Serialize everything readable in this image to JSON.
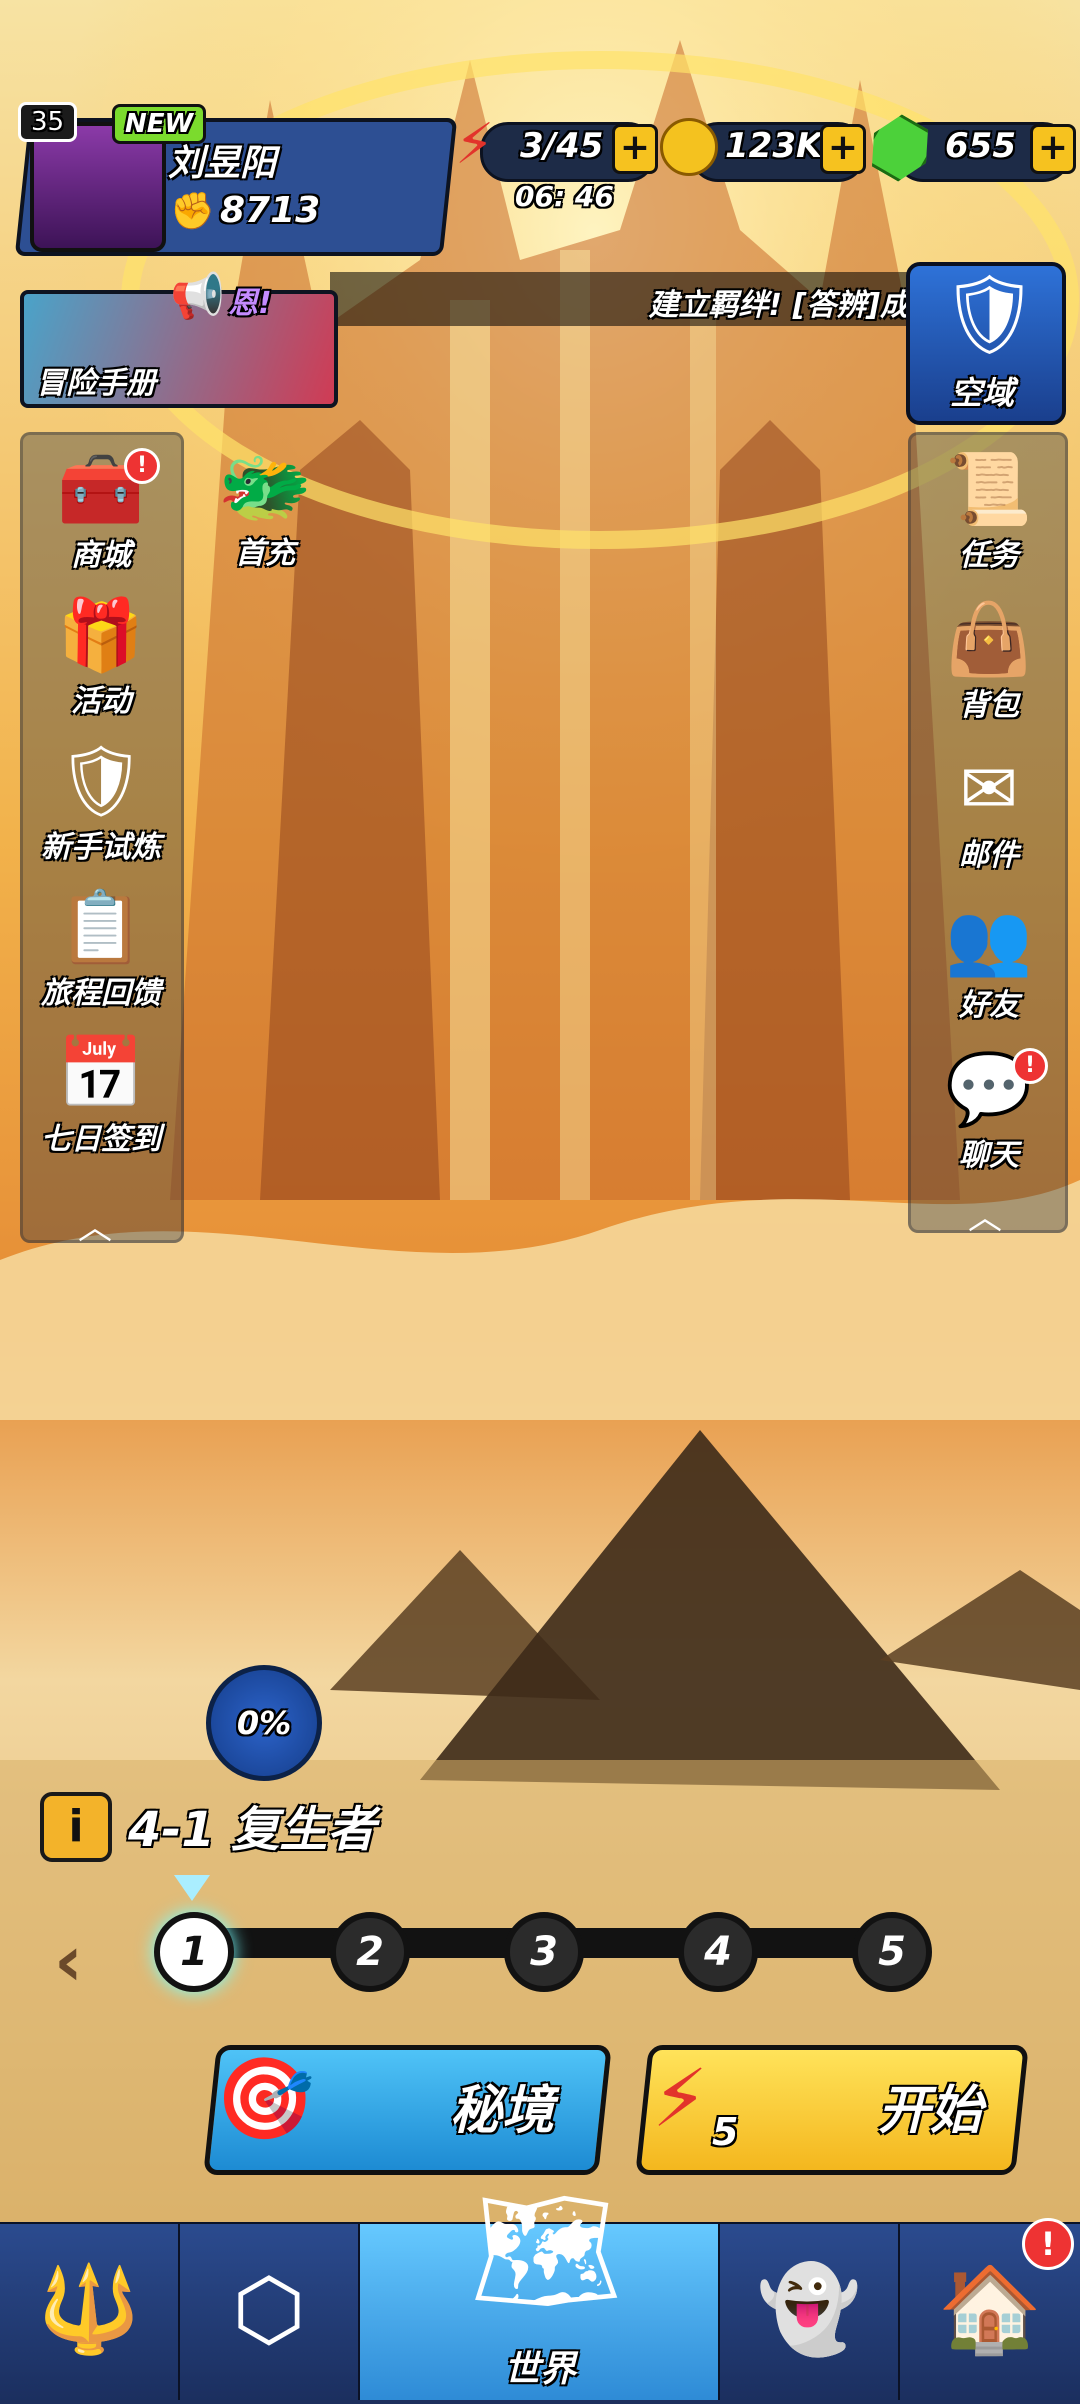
{
  "player": {
    "level": "35",
    "new_badge": "NEW",
    "name": "刘昱阳",
    "power": "8713"
  },
  "resources": {
    "energy": "3/45",
    "energy_timer": "06: 46",
    "gold": "123K",
    "gems": "655",
    "plus": "+"
  },
  "banner": {
    "manual_label": "冒险手册",
    "news_prefix": "恩!",
    "news_text": "建立羁绊! [答辨]成"
  },
  "realm": {
    "label": "空域"
  },
  "left_menu": [
    {
      "label": "商城",
      "icon": "treasure-chest-icon",
      "glyph": "🧰",
      "alert": true
    },
    {
      "label": "活动",
      "icon": "gift-chest-icon",
      "glyph": "🎁",
      "alert": false
    },
    {
      "label": "新手试炼",
      "icon": "shield-sword-icon",
      "glyph": "🛡",
      "alert": false
    },
    {
      "label": "旅程回馈",
      "icon": "clipboard-icon",
      "glyph": "📋",
      "alert": false
    },
    {
      "label": "七日签到",
      "icon": "calendar-icon",
      "glyph": "📅",
      "alert": false
    }
  ],
  "first_pay": {
    "label": "首充",
    "glyph": "🐲"
  },
  "right_menu": [
    {
      "label": "任务",
      "icon": "scroll-icon",
      "glyph": "📜",
      "alert": false
    },
    {
      "label": "背包",
      "icon": "bag-icon",
      "glyph": "👜",
      "alert": false
    },
    {
      "label": "邮件",
      "icon": "mail-icon",
      "glyph": "✉",
      "alert": false
    },
    {
      "label": "好友",
      "icon": "friends-icon",
      "glyph": "👥",
      "alert": false
    },
    {
      "label": "聊天",
      "icon": "chat-icon",
      "glyph": "💬",
      "alert": true
    }
  ],
  "stage": {
    "progress": "0%",
    "info_icon": "i",
    "name": "4-1 复生者",
    "nodes": [
      "1",
      "2",
      "3",
      "4",
      "5"
    ],
    "active_node": 1
  },
  "actions": {
    "secret_label": "秘境",
    "start_label": "开始",
    "start_cost": "5"
  },
  "nav": {
    "world_label": "世界",
    "alert": "!"
  },
  "colors": {
    "accent_blue": "#2e8bd6",
    "accent_yellow": "#f4b71e",
    "alert_red": "#e33333",
    "background": "#e7b14a"
  }
}
